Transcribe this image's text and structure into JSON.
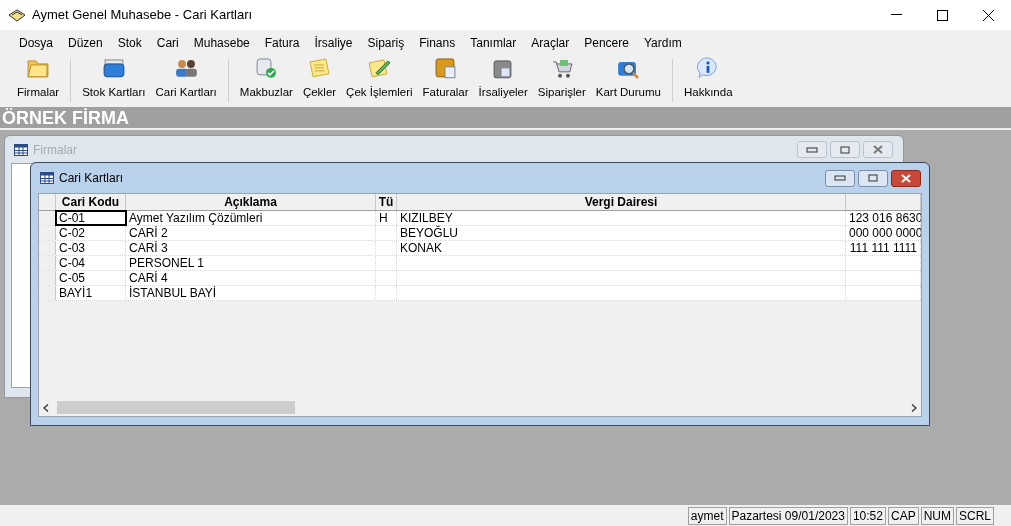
{
  "window": {
    "title": "Aymet Genel Muhasebe - Cari Kartları"
  },
  "menu": [
    "Dosya",
    "Düzen",
    "Stok",
    "Cari",
    "Muhasebe",
    "Fatura",
    "İrsaliye",
    "Sipariş",
    "Finans",
    "Tanımlar",
    "Araçlar",
    "Pencere",
    "Yardım"
  ],
  "toolbar_groups": [
    [
      {
        "label": "Firmalar",
        "kind": "folder"
      }
    ],
    [
      {
        "label": "Stok Kartları",
        "kind": "box"
      },
      {
        "label": "Cari Kartları",
        "kind": "people"
      }
    ],
    [
      {
        "label": "Makbuzlar",
        "kind": "receipt"
      },
      {
        "label": "Çekler",
        "kind": "note"
      },
      {
        "label": "Çek İşlemleri",
        "kind": "pencil"
      },
      {
        "label": "Faturalar",
        "kind": "invoice"
      },
      {
        "label": "İrsaliyeler",
        "kind": "bag"
      },
      {
        "label": "Siparişler",
        "kind": "cart"
      },
      {
        "label": "Kart Durumu",
        "kind": "search"
      }
    ],
    [
      {
        "label": "Hakkında",
        "kind": "info"
      }
    ]
  ],
  "company": "ÖRNEK FİRMA",
  "back_window": {
    "title": "Firmalar",
    "active": false
  },
  "front_window": {
    "title": "Cari Kartları",
    "active": true
  },
  "table": {
    "columns": [
      "Cari Kodu",
      "Açıklama",
      "Tü",
      "Vergi Dairesi"
    ],
    "rows": [
      {
        "cells": [
          "C-01",
          "Aymet Yazılım Çözümleri",
          "H",
          "KIZILBEY",
          "123 016 8630"
        ],
        "selected": true
      },
      {
        "cells": [
          "C-02",
          "CARİ 2",
          "",
          "BEYOĞLU",
          "000 000 0000"
        ],
        "selected": false
      },
      {
        "cells": [
          "C-03",
          "CARİ 3",
          "",
          "KONAK",
          "111 111 1111"
        ],
        "selected": false
      },
      {
        "cells": [
          "C-04",
          "PERSONEL 1",
          "",
          "",
          ""
        ],
        "selected": false
      },
      {
        "cells": [
          "C-05",
          "CARİ 4",
          "",
          "",
          ""
        ],
        "selected": false
      },
      {
        "cells": [
          "BAYİ1",
          "İSTANBUL BAYİ",
          "",
          "",
          ""
        ],
        "selected": false
      }
    ]
  },
  "status_bar": [
    "aymet",
    "Pazartesi 09/01/2023",
    "10:52",
    "CAP",
    "NUM",
    "SCRL"
  ]
}
